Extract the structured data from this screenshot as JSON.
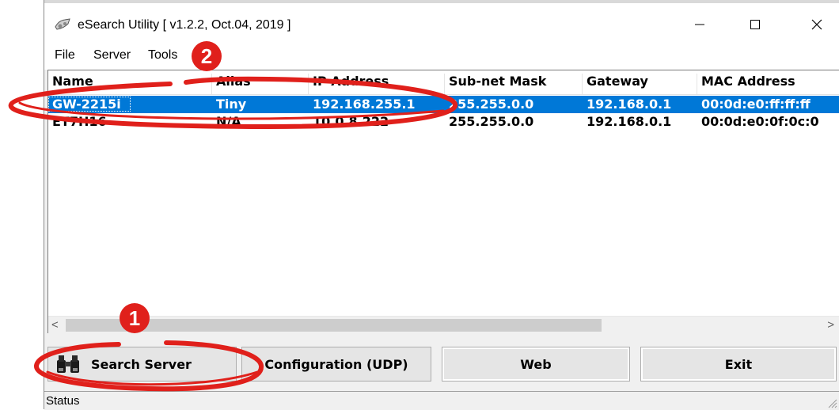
{
  "window": {
    "title": "eSearch Utility [ v1.2.2, Oct.04, 2019 ]",
    "controls": {
      "minimize": "—",
      "maximize": "☐",
      "close": "✕"
    }
  },
  "menu": [
    "File",
    "Server",
    "Tools"
  ],
  "table": {
    "columns": [
      "Name",
      "Alias",
      "IP Address",
      "Sub-net Mask",
      "Gateway",
      "MAC Address"
    ],
    "rows": [
      {
        "name": "GW-2215i",
        "alias": "Tiny",
        "ip": "192.168.255.1",
        "mask": "255.255.0.0",
        "gateway": "192.168.0.1",
        "mac": "00:0d:e0:ff:ff:ff",
        "selected": true
      },
      {
        "name": "ET7H16",
        "alias": "N/A",
        "ip": "10.0.8.222",
        "mask": "255.255.0.0",
        "gateway": "192.168.0.1",
        "mac": "00:0d:e0:0f:0c:0"
      }
    ]
  },
  "scrollbar": {
    "left_arrow": "<",
    "right_arrow": ">"
  },
  "buttons": {
    "search": "Search Server",
    "config": "Configuration (UDP)",
    "web": "Web",
    "exit": "Exit"
  },
  "status": "Status",
  "annotations": {
    "badge1": "1",
    "badge2": "2",
    "color": "#e0201b"
  },
  "colors": {
    "selection": "#0078d7",
    "annotation": "#e0201b"
  }
}
